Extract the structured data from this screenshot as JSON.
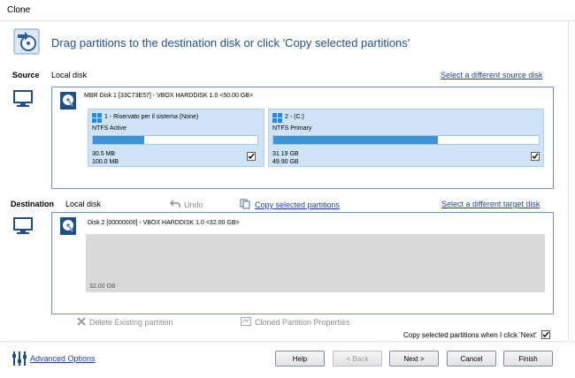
{
  "window": {
    "title": "Clone"
  },
  "header": {
    "instruction": "Drag partitions to the destination disk or click 'Copy selected partitions'"
  },
  "source": {
    "label": "Source",
    "disk_type": "Local disk",
    "select_link": "Select a different source disk",
    "disk_title": "MBR Disk 1 [33C73E57] - VBOX HARDDISK 1.0  <50.00 GB>",
    "partitions": [
      {
        "title": "1 - Riservato per il sistema (None)",
        "fs": "NTFS Active",
        "used": "30.5 MB",
        "total": "100.0 MB",
        "fill_percent": 31,
        "checked": true
      },
      {
        "title": "2 - (C:)",
        "fs": "NTFS Primary",
        "used": "31.19 GB",
        "total": "49.90 GB",
        "fill_percent": 62,
        "checked": true
      }
    ],
    "disk_checked": true
  },
  "destination": {
    "label": "Destination",
    "disk_type": "Local disk",
    "undo_label": "Undo",
    "copy_link": "Copy selected partitions",
    "select_link": "Select a different target disk",
    "disk_title": "Disk 2 [00000000] - VBOX HARDDISK 1.0  <32.00 GB>",
    "unallocated_size": "32.00 GB"
  },
  "actions": {
    "delete_label": "Delete Existing partition",
    "properties_label": "Cloned Partition Properties",
    "copy_on_next_label": "Copy selected partitions when I click 'Next'",
    "copy_on_next_checked": true
  },
  "footer": {
    "advanced_link": "Advanced Options",
    "help": "Help",
    "back": "< Back",
    "next": "Next >",
    "cancel": "Cancel",
    "finish": "Finish"
  },
  "colors": {
    "accent": "#1f4f86",
    "bar": "#3e93d8",
    "partition_bg": "#cfe3f6",
    "panel_border": "#6f93c9"
  }
}
